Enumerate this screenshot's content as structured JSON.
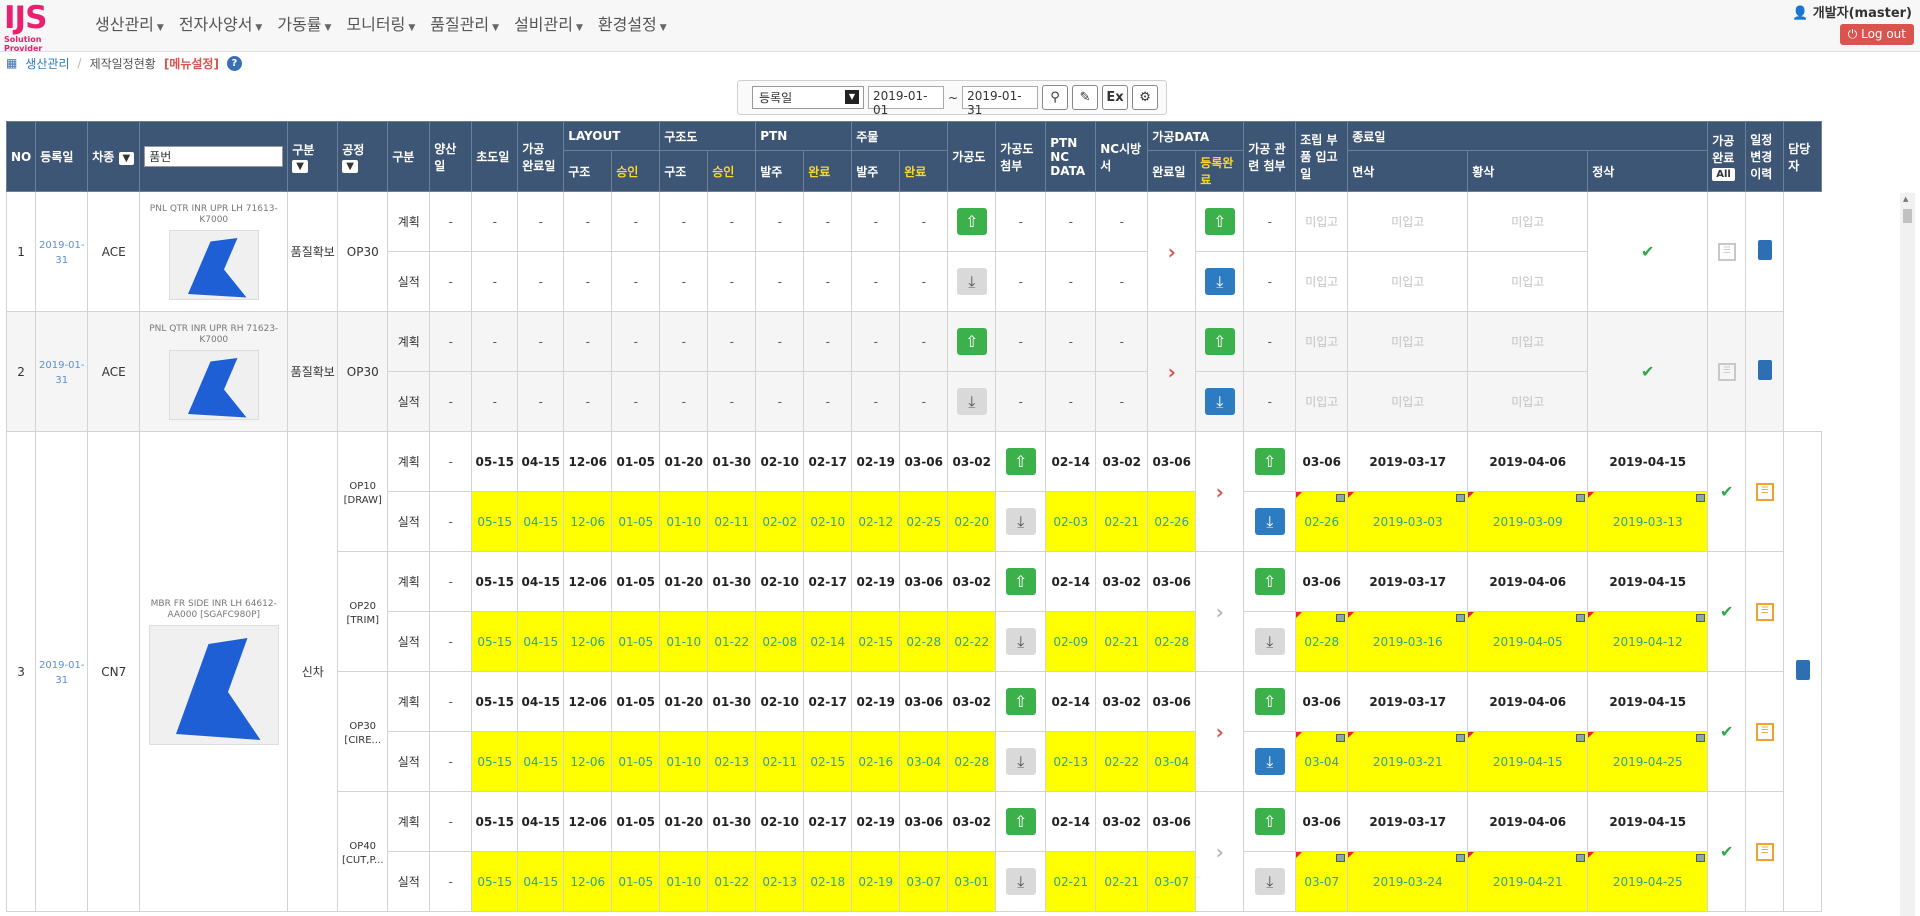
{
  "nav": {
    "logo": "IJS",
    "logo_sub": "Solution Provider",
    "menu": [
      "생산관리",
      "전자사양서",
      "가동률",
      "모니터링",
      "품질관리",
      "설비관리",
      "환경설정"
    ],
    "user": "개발자(master)",
    "logout": "Log out"
  },
  "breadcrumb": {
    "section": "생산관리",
    "page": "제작일정현황",
    "menu_setting": "[메뉴설정]"
  },
  "filter": {
    "field": "등록일",
    "from": "2019-01-01",
    "tilde": "~",
    "to": "2019-01-31",
    "excel": "Ex"
  },
  "header": {
    "no": "NO",
    "reg": "등록일",
    "car": "차종",
    "part": "품번",
    "div1": "구분",
    "proc": "공정",
    "div2": "구분",
    "mass": "양산일",
    "first": "초도일",
    "proc_done": "가공 완료일",
    "layout": "LAYOUT",
    "layout_a": "구조",
    "layout_b": "승인",
    "struct": "구조도",
    "struct_a": "구조",
    "struct_b": "승인",
    "ptn": "PTN",
    "ptn_a": "발주",
    "ptn_b": "완료",
    "cast": "주물",
    "cast_a": "발주",
    "cast_b": "완료",
    "procdraw": "가공도",
    "procdraw_att": "가공도 첨부",
    "ptn_nc": "PTN NC DATA",
    "nc_method": "NC시방서",
    "procdata": "가공DATA",
    "procdata_a": "완료일",
    "procdata_b": "등록완료",
    "rel_att": "가공 관련 첨부",
    "assy": "조립 부품 입고일",
    "end": "종료일",
    "end_a": "면삭",
    "end_b": "황삭",
    "end_c": "정삭",
    "fin": "가공 완료",
    "all_btn": "All",
    "hist": "일정 변경 이력",
    "mgr": "담당 자"
  },
  "rows": [
    {
      "no": "1",
      "reg": "2019-01-31",
      "car": "ACE",
      "part": "PNL QTR INR UPR LH 71613-K7000",
      "div1": "품질확보",
      "proc": "OP30",
      "plan": {
        "label": "계획",
        "vals": [
          "-",
          "-",
          "-",
          "-",
          "-",
          "-",
          "-",
          "-",
          "-",
          "-",
          "-"
        ],
        "nc": [
          "-",
          "-",
          "-"
        ],
        "assy": "-",
        "end": [
          "미입고",
          "미입고",
          "미입고"
        ]
      },
      "act": {
        "label": "실적",
        "vals": [
          "-",
          "-",
          "-",
          "-",
          "-",
          "-",
          "-",
          "-",
          "-",
          "-",
          "-"
        ],
        "nc": [
          "-",
          "-",
          "-"
        ],
        "assy": "-",
        "end": [
          "미입고",
          "미입고",
          "미입고"
        ]
      },
      "chevron": "red"
    },
    {
      "no": "2",
      "reg": "2019-01-31",
      "car": "ACE",
      "part": "PNL QTR INR UPR RH 71623-K7000",
      "div1": "품질확보",
      "proc": "OP30",
      "plan": {
        "label": "계획",
        "vals": [
          "-",
          "-",
          "-",
          "-",
          "-",
          "-",
          "-",
          "-",
          "-",
          "-",
          "-"
        ],
        "nc": [
          "-",
          "-",
          "-"
        ],
        "assy": "-",
        "end": [
          "미입고",
          "미입고",
          "미입고"
        ]
      },
      "act": {
        "label": "실적",
        "vals": [
          "-",
          "-",
          "-",
          "-",
          "-",
          "-",
          "-",
          "-",
          "-",
          "-",
          "-"
        ],
        "nc": [
          "-",
          "-",
          "-"
        ],
        "assy": "-",
        "end": [
          "미입고",
          "미입고",
          "미입고"
        ]
      },
      "chevron": "red"
    }
  ],
  "row3": {
    "no": "3",
    "reg": "2019-01-31",
    "car": "CN7",
    "part": "MBR FR SIDE INR LH 64612-AA000 [SGAFC980P]",
    "div1": "신차",
    "ops": [
      {
        "proc": "OP10 [DRAW]",
        "plan": [
          "-",
          "05-15",
          "04-15",
          "12-06",
          "01-05",
          "01-20",
          "01-30",
          "02-10",
          "02-17",
          "02-19",
          "03-06",
          "03-02"
        ],
        "plan_nc": [
          "02-14",
          "03-02",
          "03-06"
        ],
        "plan_assy": "03-06",
        "plan_end": [
          "2019-03-17",
          "2019-04-06",
          "2019-04-15"
        ],
        "act": [
          "-",
          "05-15",
          "04-15",
          "12-06",
          "01-05",
          "01-10",
          "02-11",
          "02-02",
          "02-10",
          "02-12",
          "02-25",
          "02-20"
        ],
        "act_nc": [
          "02-03",
          "02-21",
          "02-26"
        ],
        "act_assy": "02-26",
        "act_end": [
          "2019-03-03",
          "2019-03-09",
          "2019-03-13"
        ],
        "chevron": "red",
        "dl_blue": true
      },
      {
        "proc": "OP20 [TRIM]",
        "plan": [
          "-",
          "05-15",
          "04-15",
          "12-06",
          "01-05",
          "01-20",
          "01-30",
          "02-10",
          "02-17",
          "02-19",
          "03-06",
          "03-02"
        ],
        "plan_nc": [
          "02-14",
          "03-02",
          "03-06"
        ],
        "plan_assy": "03-06",
        "plan_end": [
          "2019-03-17",
          "2019-04-06",
          "2019-04-15"
        ],
        "act": [
          "-",
          "05-15",
          "04-15",
          "12-06",
          "01-05",
          "01-10",
          "01-22",
          "02-08",
          "02-14",
          "02-15",
          "02-28",
          "02-22"
        ],
        "act_nc": [
          "02-09",
          "02-21",
          "02-28"
        ],
        "act_assy": "02-28",
        "act_end": [
          "2019-03-16",
          "2019-04-05",
          "2019-04-12"
        ],
        "chevron": "gray",
        "dl_blue": false
      },
      {
        "proc": "OP30 [CIRE...",
        "plan": [
          "-",
          "05-15",
          "04-15",
          "12-06",
          "01-05",
          "01-20",
          "01-30",
          "02-10",
          "02-17",
          "02-19",
          "03-06",
          "03-02"
        ],
        "plan_nc": [
          "02-14",
          "03-02",
          "03-06"
        ],
        "plan_assy": "03-06",
        "plan_end": [
          "2019-03-17",
          "2019-04-06",
          "2019-04-15"
        ],
        "act": [
          "-",
          "05-15",
          "04-15",
          "12-06",
          "01-05",
          "01-10",
          "02-13",
          "02-11",
          "02-15",
          "02-16",
          "03-04",
          "02-28"
        ],
        "act_nc": [
          "02-13",
          "02-22",
          "03-04"
        ],
        "act_assy": "03-04",
        "act_end": [
          "2019-03-21",
          "2019-04-15",
          "2019-04-25"
        ],
        "chevron": "red",
        "dl_blue": true
      },
      {
        "proc": "OP40 [CUT,P...",
        "plan": [
          "-",
          "05-15",
          "04-15",
          "12-06",
          "01-05",
          "01-20",
          "01-30",
          "02-10",
          "02-17",
          "02-19",
          "03-06",
          "03-02"
        ],
        "plan_nc": [
          "02-14",
          "03-02",
          "03-06"
        ],
        "plan_assy": "03-06",
        "plan_end": [
          "2019-03-17",
          "2019-04-06",
          "2019-04-15"
        ],
        "act": [
          "-",
          "05-15",
          "04-15",
          "12-06",
          "01-05",
          "01-10",
          "01-22",
          "02-13",
          "02-18",
          "02-19",
          "03-07",
          "03-01"
        ],
        "act_nc": [
          "02-21",
          "02-21",
          "03-07"
        ],
        "act_assy": "03-07",
        "act_end": [
          "2019-03-24",
          "2019-04-21",
          "2019-04-25"
        ],
        "chevron": "gray",
        "dl_blue": false
      }
    ]
  },
  "labels": {
    "plan": "계획",
    "act": "실적"
  }
}
